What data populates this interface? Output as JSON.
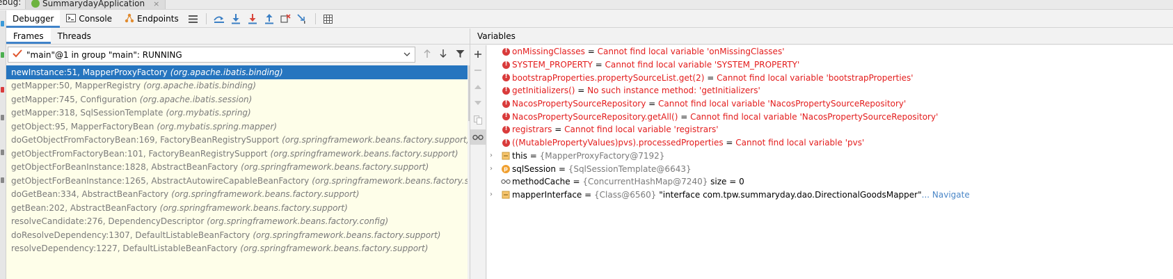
{
  "titlebar": {
    "debug_label": "ebug:",
    "run_tab_label": "SummarydayApplication",
    "close_glyph": "×"
  },
  "toolbar": {
    "tabs": [
      {
        "label": "Debugger",
        "active": true
      },
      {
        "label": "Console",
        "active": false
      },
      {
        "label": "Endpoints",
        "active": false
      }
    ],
    "icons": [
      "menu-icon",
      "show-execution-point-icon",
      "step-over-icon",
      "step-into-icon",
      "force-step-into-icon",
      "step-out-icon",
      "drop-frame-icon",
      "run-to-cursor-icon",
      "evaluate-expression-icon"
    ]
  },
  "frames_pane": {
    "subtabs": [
      {
        "label": "Frames",
        "active": true
      },
      {
        "label": "Threads",
        "active": false
      }
    ],
    "thread": "\"main\"@1 in group \"main\": RUNNING",
    "frames": [
      {
        "method": "newInstance:51, MapperProxyFactory",
        "location": "(org.apache.ibatis.binding)",
        "selected": true
      },
      {
        "method": "getMapper:50, MapperRegistry",
        "location": "(org.apache.ibatis.binding)",
        "selected": false
      },
      {
        "method": "getMapper:745, Configuration",
        "location": "(org.apache.ibatis.session)",
        "selected": false
      },
      {
        "method": "getMapper:318, SqlSessionTemplate",
        "location": "(org.mybatis.spring)",
        "selected": false
      },
      {
        "method": "getObject:95, MapperFactoryBean",
        "location": "(org.mybatis.spring.mapper)",
        "selected": false
      },
      {
        "method": "doGetObjectFromFactoryBean:169, FactoryBeanRegistrySupport",
        "location": "(org.springframework.beans.factory.support)",
        "selected": false
      },
      {
        "method": "getObjectFromFactoryBean:101, FactoryBeanRegistrySupport",
        "location": "(org.springframework.beans.factory.support)",
        "selected": false
      },
      {
        "method": "getObjectForBeanInstance:1828, AbstractBeanFactory",
        "location": "(org.springframework.beans.factory.support)",
        "selected": false
      },
      {
        "method": "getObjectForBeanInstance:1265, AbstractAutowireCapableBeanFactory",
        "location": "(org.springframework.beans.factory.support)",
        "selected": false
      },
      {
        "method": "doGetBean:334, AbstractBeanFactory",
        "location": "(org.springframework.beans.factory.support)",
        "selected": false
      },
      {
        "method": "getBean:202, AbstractBeanFactory",
        "location": "(org.springframework.beans.factory.support)",
        "selected": false
      },
      {
        "method": "resolveCandidate:276, DependencyDescriptor",
        "location": "(org.springframework.beans.factory.config)",
        "selected": false
      },
      {
        "method": "doResolveDependency:1307, DefaultListableBeanFactory",
        "location": "(org.springframework.beans.factory.support)",
        "selected": false
      },
      {
        "method": "resolveDependency:1227, DefaultListableBeanFactory",
        "location": "(org.springframework.beans.factory.support)",
        "selected": false
      }
    ]
  },
  "variables_pane": {
    "header": "Variables",
    "items": [
      {
        "kind": "error",
        "name": "onMissingClasses",
        "eq": " = ",
        "value": "Cannot find local variable 'onMissingClasses'"
      },
      {
        "kind": "error",
        "name": "SYSTEM_PROPERTY",
        "eq": " = ",
        "value": "Cannot find local variable 'SYSTEM_PROPERTY'"
      },
      {
        "kind": "error",
        "name": "bootstrapProperties.propertySourceList.get(2)",
        "eq": " = ",
        "value": "Cannot find local variable 'bootstrapProperties'"
      },
      {
        "kind": "error",
        "name": "getInitializers()",
        "eq": " = ",
        "value": "No such instance method: 'getInitializers'"
      },
      {
        "kind": "error",
        "name": "NacosPropertySourceRepository",
        "eq": " = ",
        "value": "Cannot find local variable 'NacosPropertySourceRepository'"
      },
      {
        "kind": "error",
        "name": "NacosPropertySourceRepository.getAll()",
        "eq": " = ",
        "value": "Cannot find local variable 'NacosPropertySourceRepository'"
      },
      {
        "kind": "error",
        "name": "registrars",
        "eq": " = ",
        "value": "Cannot find local variable 'registrars'"
      },
      {
        "kind": "error",
        "name": "((MutablePropertyValues)pvs).processedProperties",
        "eq": " = ",
        "value": "Cannot find local variable 'pvs'"
      },
      {
        "kind": "object",
        "name": "this",
        "eq": " = ",
        "type": "{MapperProxyFactory@7192}",
        "extra": "",
        "link": ""
      },
      {
        "kind": "param",
        "name": "sqlSession",
        "eq": " = ",
        "type": "{SqlSessionTemplate@6643}",
        "extra": "",
        "link": ""
      },
      {
        "kind": "watch",
        "name": "methodCache",
        "eq": " = ",
        "type": "{ConcurrentHashMap@7240}",
        "extra": "  size = 0",
        "link": ""
      },
      {
        "kind": "object",
        "name": "mapperInterface",
        "eq": " = ",
        "type": "{Class@6560}",
        "extra": " \"interface com.tpw.summaryday.dao.DirectionalGoodsMapper\"",
        "link": "... Navigate"
      }
    ]
  },
  "colors": {
    "accent": "#4083c9",
    "selection": "#2675bf",
    "error": "#e31c1c",
    "frames_bg": "#fefee9"
  }
}
